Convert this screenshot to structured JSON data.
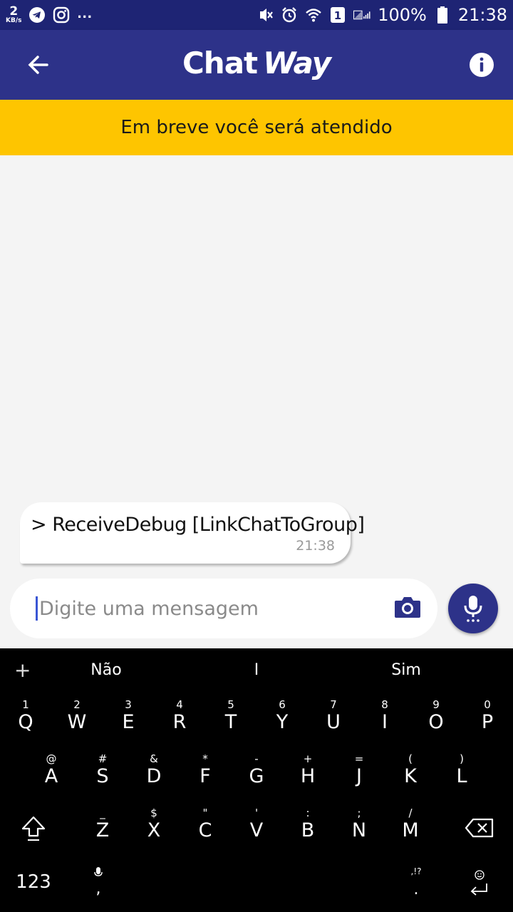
{
  "statusbar": {
    "speed_value": "2",
    "speed_unit": "KB/s",
    "more": "...",
    "sim": "1",
    "battery": "100%",
    "time": "21:38"
  },
  "appbar": {
    "brand_chat": "Chat",
    "brand_way": "Way",
    "back_icon": "arrow-left",
    "info_icon": "info-circle"
  },
  "banner": {
    "text": "Em breve você será atendido"
  },
  "chat": {
    "messages": [
      {
        "text": "> ReceiveDebug [LinkChatToGroup]",
        "time": "21:38"
      }
    ]
  },
  "composer": {
    "placeholder": "Digite uma mensagem",
    "camera_icon": "camera",
    "mic_icon": "microphone"
  },
  "keyboard": {
    "suggestions": [
      "+",
      "Não",
      "I",
      "Sim"
    ],
    "row1": [
      {
        "main": "Q",
        "alt": "1"
      },
      {
        "main": "W",
        "alt": "2"
      },
      {
        "main": "E",
        "alt": "3"
      },
      {
        "main": "R",
        "alt": "4"
      },
      {
        "main": "T",
        "alt": "5"
      },
      {
        "main": "Y",
        "alt": "6"
      },
      {
        "main": "U",
        "alt": "7"
      },
      {
        "main": "I",
        "alt": "8"
      },
      {
        "main": "O",
        "alt": "9"
      },
      {
        "main": "P",
        "alt": "0"
      }
    ],
    "row2": [
      {
        "main": "A",
        "alt": "@"
      },
      {
        "main": "S",
        "alt": "#"
      },
      {
        "main": "D",
        "alt": "&"
      },
      {
        "main": "F",
        "alt": "*"
      },
      {
        "main": "G",
        "alt": "-"
      },
      {
        "main": "H",
        "alt": "+"
      },
      {
        "main": "J",
        "alt": "="
      },
      {
        "main": "K",
        "alt": "("
      },
      {
        "main": "L",
        "alt": ")"
      }
    ],
    "row3": [
      {
        "main": "Z",
        "alt": "_"
      },
      {
        "main": "X",
        "alt": "$"
      },
      {
        "main": "C",
        "alt": "\""
      },
      {
        "main": "V",
        "alt": "'"
      },
      {
        "main": "B",
        "alt": ":"
      },
      {
        "main": "N",
        "alt": ";"
      },
      {
        "main": "M",
        "alt": "/"
      }
    ],
    "numbers_label": "123",
    "comma_label": ",",
    "period_label": ".",
    "punct_hint": ",!?"
  }
}
